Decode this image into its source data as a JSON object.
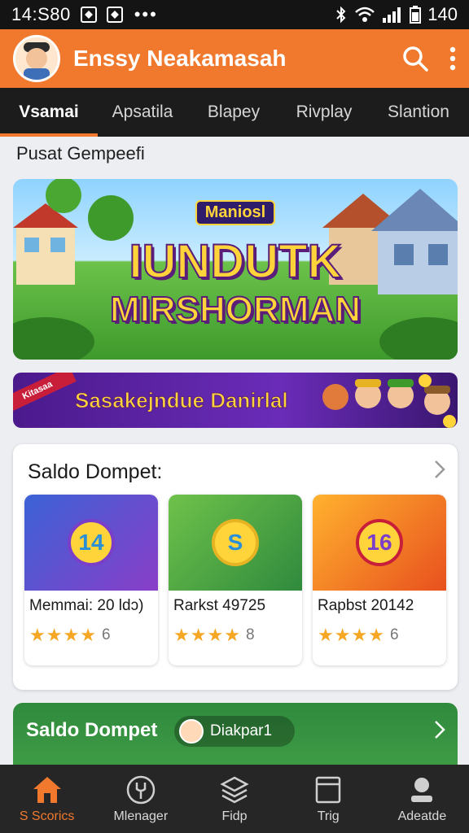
{
  "status_bar": {
    "time": "14:S80",
    "battery": "140"
  },
  "app_bar": {
    "title": "Enssy Neakamasah"
  },
  "tabs": [
    {
      "label": "Vsamai",
      "active": true
    },
    {
      "label": "Apsatila",
      "active": false
    },
    {
      "label": "Blapey",
      "active": false
    },
    {
      "label": "Rivplay",
      "active": false
    },
    {
      "label": "Slantion",
      "active": false
    }
  ],
  "section_title": "Pusat Gempeefi",
  "hero": {
    "badge": "Maniosl",
    "line1": "IUNDUTK",
    "line2": "MIRSHORMAN"
  },
  "promo": {
    "text": "Sasakejndue Danirlal",
    "ribbon": "Kitasaa"
  },
  "wallet_card": {
    "title": "Saldo Dompet:",
    "games": [
      {
        "name": "Memmai: 20 ldɔ)",
        "thumb_number": "14",
        "rating_stars": 4,
        "rating_count": "6"
      },
      {
        "name": "Rarkst 49725",
        "thumb_number": "S",
        "rating_stars": 4,
        "rating_count": "8"
      },
      {
        "name": "Rapbst 20142",
        "thumb_number": "16",
        "rating_stars": 4,
        "rating_count": "6"
      }
    ]
  },
  "lower_card": {
    "title": "Saldo Dompet",
    "pill_text": "Diakpar1"
  },
  "bottom_nav": [
    {
      "label": "S Scorics",
      "icon": "home-icon",
      "active": true
    },
    {
      "label": "Mlenager",
      "icon": "wrench-icon",
      "active": false
    },
    {
      "label": "Fidp",
      "icon": "layers-icon",
      "active": false
    },
    {
      "label": "Trig",
      "icon": "box-icon",
      "active": false
    },
    {
      "label": "Adeatde",
      "icon": "person-icon",
      "active": false
    }
  ],
  "colors": {
    "accent": "#f0792e",
    "tab_bg": "#1c1c1c",
    "nav_bg": "#262626",
    "star": "#f5a623"
  }
}
